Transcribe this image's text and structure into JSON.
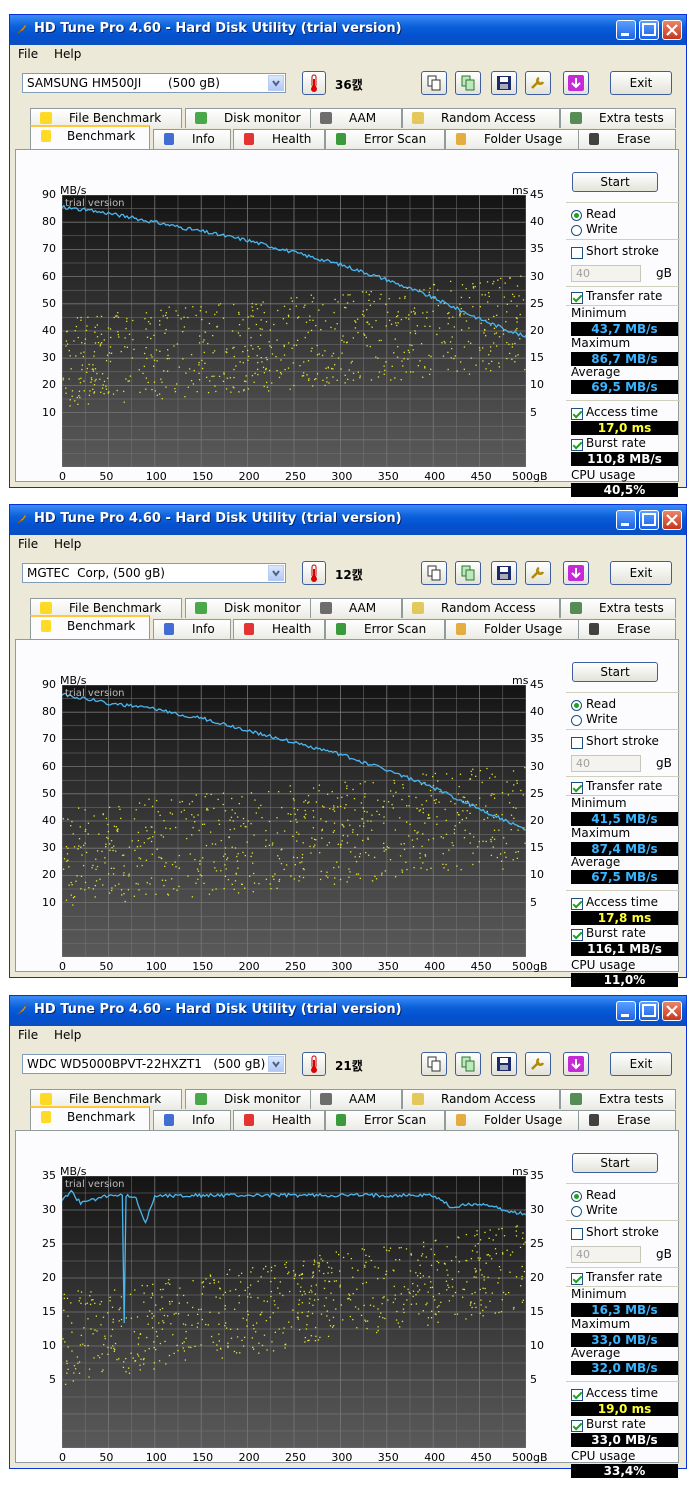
{
  "window_title": "HD Tune Pro 4.60 - Hard Disk Utility (trial version)",
  "menu": {
    "file": "File",
    "help": "Help"
  },
  "tabs_top": [
    "File Benchmark",
    "Disk monitor",
    "AAM",
    "Random Access",
    "Extra tests"
  ],
  "tabs_bottom": [
    "Benchmark",
    "Info",
    "Health",
    "Error Scan",
    "Folder Usage",
    "Erase"
  ],
  "exit_label": "Exit",
  "start_label": "Start",
  "read_label": "Read",
  "write_label": "Write",
  "short_stroke_label": "Short stroke",
  "stroke_value": "40",
  "gb_label": "gB",
  "transfer_rate_label": "Transfer rate",
  "minimum_label": "Minimum",
  "maximum_label": "Maximum",
  "average_label": "Average",
  "access_time_label": "Access time",
  "burst_rate_label": "Burst rate",
  "cpu_usage_label": "CPU usage",
  "watermark": "trial version",
  "y_unit_left": "MB/s",
  "y_unit_right": "ms",
  "colors": {
    "transfer_line": "#4ab6f0",
    "access_dots": "#e6e632",
    "min_max_avg_text": "#3cb4ff",
    "access_text": "#ffff32",
    "white_text": "#ffffff"
  },
  "windows": [
    {
      "drive": "SAMSUNG HM500JI       (500 gB)",
      "temperature": "36캜",
      "results": {
        "minimum": "43,7 MB/s",
        "maximum": "86,7 MB/s",
        "average": "69,5 MB/s",
        "access_time": "17,0 ms",
        "burst_rate": "110,8 MB/s",
        "cpu_usage": "40,5%"
      },
      "chart_data": {
        "type": "line",
        "x_ticks": [
          "0",
          "50",
          "100",
          "150",
          "200",
          "250",
          "300",
          "350",
          "400",
          "450",
          "500gB"
        ],
        "y_ticks_left": [
          "90",
          "80",
          "70",
          "60",
          "50",
          "40",
          "30",
          "20",
          "10"
        ],
        "y_ticks_right": [
          "45",
          "40",
          "35",
          "30",
          "25",
          "20",
          "15",
          "10",
          "5"
        ],
        "xlim": [
          0,
          500
        ],
        "ylim_left": [
          0,
          90
        ],
        "ylim_right": [
          0,
          45
        ],
        "series": [
          {
            "x": [
              0,
              50,
              100,
              150,
              200,
              250,
              300,
              350,
              400,
              450,
              500
            ],
            "values": [
              86,
              84,
              81,
              78,
              75,
              71,
              67,
              62,
              56,
              49,
              43
            ]
          }
        ],
        "access_spread": {
          "x_start_ms": [
            10,
            25
          ],
          "x_end_ms": [
            16,
            32
          ]
        },
        "grid": true
      }
    },
    {
      "drive": "MGTEC  Corp, (500 gB)",
      "temperature": "12캜",
      "results": {
        "minimum": "41,5 MB/s",
        "maximum": "87,4 MB/s",
        "average": "67,5 MB/s",
        "access_time": "17,8 ms",
        "burst_rate": "116,1 MB/s",
        "cpu_usage": "11,0%"
      },
      "chart_data": {
        "type": "line",
        "x_ticks": [
          "0",
          "50",
          "100",
          "150",
          "200",
          "250",
          "300",
          "350",
          "400",
          "450",
          "500gB"
        ],
        "y_ticks_left": [
          "90",
          "80",
          "70",
          "60",
          "50",
          "40",
          "30",
          "20",
          "10"
        ],
        "y_ticks_right": [
          "45",
          "40",
          "35",
          "30",
          "25",
          "20",
          "15",
          "10",
          "5"
        ],
        "xlim": [
          0,
          500
        ],
        "ylim_left": [
          0,
          90
        ],
        "ylim_right": [
          0,
          45
        ],
        "series": [
          {
            "x": [
              0,
              50,
              100,
              150,
              200,
              250,
              300,
              350,
              400,
              450,
              500
            ],
            "values": [
              87,
              84,
              82,
              79,
              75,
              71,
              67,
              62,
              56,
              49,
              42
            ]
          }
        ],
        "access_spread": {
          "x_start_ms": [
            8,
            25
          ],
          "x_end_ms": [
            15,
            32
          ]
        },
        "grid": true
      }
    },
    {
      "drive": "WDC WD5000BPVT-22HXZT1   (500 gB)",
      "temperature": "21캜",
      "results": {
        "minimum": "16,3 MB/s",
        "maximum": "33,0 MB/s",
        "average": "32,0 MB/s",
        "access_time": "19,0 ms",
        "burst_rate": "33,0 MB/s",
        "cpu_usage": "33,4%"
      },
      "chart_data": {
        "type": "line",
        "x_ticks": [
          "0",
          "50",
          "100",
          "150",
          "200",
          "250",
          "300",
          "350",
          "400",
          "450",
          "500gB"
        ],
        "y_ticks_left": [
          "35",
          "30",
          "25",
          "20",
          "15",
          "10",
          "5"
        ],
        "y_ticks_right": [
          "35",
          "30",
          "25",
          "20",
          "15",
          "10",
          "5"
        ],
        "xlim": [
          0,
          500
        ],
        "ylim_left": [
          0,
          35
        ],
        "ylim_right": [
          0,
          35
        ],
        "series": [
          {
            "x": [
              0,
              10,
              20,
              50,
              65,
              67,
              69,
              80,
              90,
              100,
              150,
              200,
              250,
              300,
              350,
              400,
              420,
              450,
              480,
              500
            ],
            "values": [
              32,
              33,
              31.5,
              32.5,
              32.5,
              16.3,
              32.5,
              32,
              29,
              32.5,
              32.5,
              32.5,
              32.5,
              32.5,
              32.5,
              32.5,
              31,
              31.5,
              30.5,
              30
            ]
          }
        ],
        "access_spread": {
          "x_start_ms": [
            8,
            20
          ],
          "x_end_ms": [
            18,
            29
          ]
        },
        "grid": true
      }
    }
  ]
}
